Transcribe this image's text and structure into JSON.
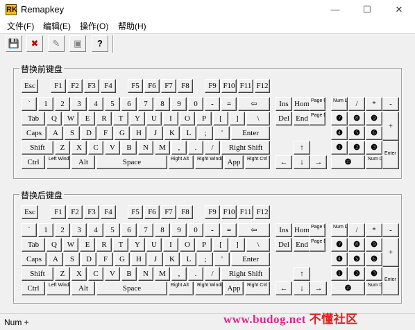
{
  "window": {
    "title": "Remapkey",
    "icon": "RK",
    "minimize": "—",
    "maximize": "☐",
    "close": "✕"
  },
  "menu": [
    {
      "label": "文件(F)"
    },
    {
      "label": "编辑(E)"
    },
    {
      "label": "操作(O)"
    },
    {
      "label": "帮助(H)"
    }
  ],
  "toolbar": [
    {
      "icon": "save-icon",
      "glyph": "💾"
    },
    {
      "icon": "delete-icon",
      "glyph": "✖"
    },
    {
      "icon": "edit-icon",
      "glyph": "✎"
    },
    {
      "icon": "view-icon",
      "glyph": "▣"
    },
    {
      "icon": "help-icon",
      "glyph": "?"
    }
  ],
  "groups": [
    {
      "title": "替换前键盘"
    },
    {
      "title": "替换后键盘"
    }
  ],
  "status": {
    "text": "Num +"
  },
  "watermark": {
    "site": "www.budog.net",
    "brand": "不懂社区"
  },
  "keys": [
    [
      "Esc"
    ],
    [
      "F1"
    ],
    [
      "F2"
    ],
    [
      "F3"
    ],
    [
      "F4"
    ],
    [
      "F5"
    ],
    [
      "F6"
    ],
    [
      "F7"
    ],
    [
      "F8"
    ],
    [
      "F9"
    ],
    [
      "F10"
    ],
    [
      "F11"
    ],
    [
      "F12"
    ],
    [
      "`"
    ],
    [
      "1"
    ],
    [
      "2"
    ],
    [
      "3"
    ],
    [
      "4"
    ],
    [
      "5"
    ],
    [
      "6"
    ],
    [
      "7"
    ],
    [
      "8"
    ],
    [
      "9"
    ],
    [
      "0"
    ],
    [
      "-"
    ],
    [
      "="
    ],
    [
      "⇦"
    ],
    [
      "Tab"
    ],
    [
      "Q"
    ],
    [
      "W"
    ],
    [
      "E"
    ],
    [
      "R"
    ],
    [
      "T"
    ],
    [
      "Y"
    ],
    [
      "U"
    ],
    [
      "I"
    ],
    [
      "O"
    ],
    [
      "P"
    ],
    [
      "["
    ],
    [
      "]"
    ],
    [
      "\\"
    ],
    [
      "Caps"
    ],
    [
      "A"
    ],
    [
      "S"
    ],
    [
      "D"
    ],
    [
      "F"
    ],
    [
      "G"
    ],
    [
      "H"
    ],
    [
      "J"
    ],
    [
      "K"
    ],
    [
      "L"
    ],
    [
      ";"
    ],
    [
      "'"
    ],
    [
      "Enter"
    ],
    [
      "Shift"
    ],
    [
      "Z"
    ],
    [
      "X"
    ],
    [
      "C"
    ],
    [
      "V"
    ],
    [
      "B"
    ],
    [
      "N"
    ],
    [
      "M"
    ],
    [
      ","
    ],
    [
      "."
    ],
    [
      "/"
    ],
    [
      "Right Shift"
    ],
    [
      "Ctrl"
    ],
    [
      "Left Windows"
    ],
    [
      "Alt"
    ],
    [
      "Space"
    ],
    [
      "Right Alt"
    ],
    [
      "Right Windows"
    ],
    [
      "App"
    ],
    [
      "Right Ctrl"
    ],
    [
      "Ins"
    ],
    [
      "Home"
    ],
    [
      "Page Up"
    ],
    [
      "Del"
    ],
    [
      "End"
    ],
    [
      "Page Down"
    ],
    [
      "↑"
    ],
    [
      "←"
    ],
    [
      "↓"
    ],
    [
      "→"
    ],
    [
      "Num Lock"
    ],
    [
      "/"
    ],
    [
      "*"
    ],
    [
      "-"
    ],
    [
      "❼"
    ],
    [
      "❽"
    ],
    [
      "❾"
    ],
    [
      "+"
    ],
    [
      "❹"
    ],
    [
      "❺"
    ],
    [
      "❻"
    ],
    [
      "❶"
    ],
    [
      "❷"
    ],
    [
      "❸"
    ],
    [
      "Enter"
    ],
    [
      "❿"
    ],
    [
      "Num Del"
    ]
  ]
}
